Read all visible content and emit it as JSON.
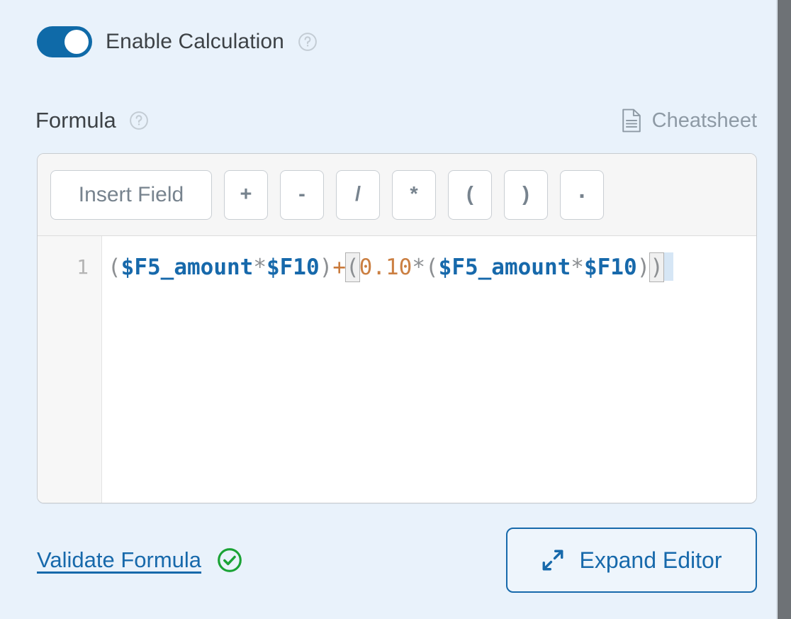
{
  "enable_calculation": {
    "label": "Enable Calculation",
    "toggle_state": "on",
    "help_icon": "help-circle-icon"
  },
  "formula_section": {
    "label": "Formula",
    "help_icon": "help-circle-icon",
    "cheatsheet": {
      "label": "Cheatsheet",
      "icon": "document-lines-icon"
    }
  },
  "editor": {
    "toolbar_buttons": [
      {
        "label": "Insert Field",
        "name": "insert-field-button",
        "kind": "wide"
      },
      {
        "label": "+",
        "name": "plus-button",
        "kind": "op"
      },
      {
        "label": "-",
        "name": "minus-button",
        "kind": "op"
      },
      {
        "label": "/",
        "name": "divide-button",
        "kind": "op"
      },
      {
        "label": "*",
        "name": "multiply-button",
        "kind": "op"
      },
      {
        "label": "(",
        "name": "open-paren-button",
        "kind": "op"
      },
      {
        "label": ")",
        "name": "close-paren-button",
        "kind": "op"
      },
      {
        "label": ".",
        "name": "dot-button",
        "kind": "dot"
      }
    ],
    "line_numbers": [
      "1"
    ],
    "formula_text": "($F5_amount*$F10)+(0.10*($F5_amount*$F10))",
    "tokens": [
      {
        "t": "(",
        "c": "paren"
      },
      {
        "t": "$F5_amount",
        "c": "var"
      },
      {
        "t": "*",
        "c": "mul"
      },
      {
        "t": "$F10",
        "c": "var"
      },
      {
        "t": ")",
        "c": "paren"
      },
      {
        "t": "+",
        "c": "op"
      },
      {
        "t": "(",
        "c": "paren",
        "hl": true
      },
      {
        "t": "0.10",
        "c": "num"
      },
      {
        "t": "*",
        "c": "mul"
      },
      {
        "t": "(",
        "c": "paren"
      },
      {
        "t": "$F5_amount",
        "c": "var"
      },
      {
        "t": "*",
        "c": "mul"
      },
      {
        "t": "$F10",
        "c": "var"
      },
      {
        "t": ")",
        "c": "paren"
      },
      {
        "t": ")",
        "c": "paren",
        "hl": true
      }
    ]
  },
  "footer": {
    "validate_link": "Validate Formula",
    "validate_status_icon": "check-circle-icon",
    "validate_status": "valid",
    "expand_editor": {
      "label": "Expand Editor",
      "icon": "expand-diagonal-arrows-icon"
    }
  },
  "colors": {
    "background": "#e9f2fb",
    "accent_blue": "#1769ab",
    "toggle_on": "#0f6aa8",
    "valid_green": "#1aa335",
    "muted_text": "#8e9aa5",
    "code_var": "#1769ab",
    "code_number": "#cb7f42",
    "code_operator": "#c9793a",
    "code_paren": "#8c8f92",
    "scrollbar": "#6e7276"
  }
}
